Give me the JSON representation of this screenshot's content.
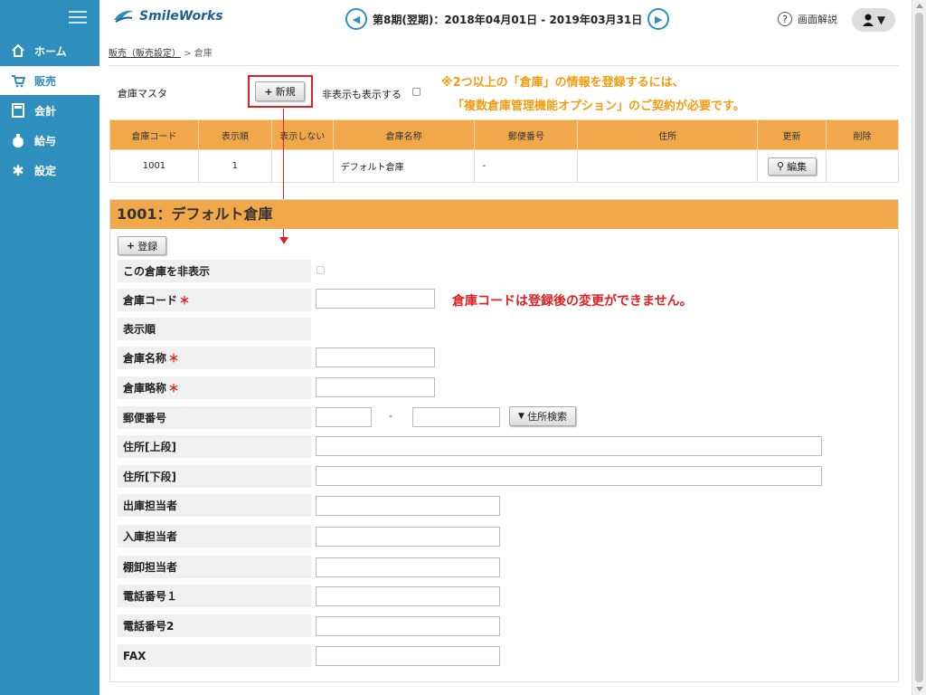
{
  "sidebar": {
    "items": [
      {
        "label": "ホーム",
        "icon": "home-icon"
      },
      {
        "label": "販売",
        "icon": "cart-icon"
      },
      {
        "label": "会計",
        "icon": "calculator-icon"
      },
      {
        "label": "給与",
        "icon": "money-bag-icon"
      },
      {
        "label": "設定",
        "icon": "gear-icon"
      }
    ]
  },
  "header": {
    "logo": "SmileWorks",
    "period": "第8期(翌期)：2018年04月01日 - 2019年03月31日",
    "help": "画面解説"
  },
  "breadcrumb": {
    "link": "販売（販売設定）",
    "sep": ">",
    "current": "倉庫"
  },
  "master": {
    "title": "倉庫マスタ",
    "new_button": "新規",
    "show_hidden": "非表示も表示する",
    "note_line1": "※2つ以上の「倉庫」の情報を登録するには、",
    "note_line2": "「複数倉庫管理機能オプション」のご契約が必要です。"
  },
  "table": {
    "headers": [
      "倉庫コード",
      "表示順",
      "表示しない",
      "倉庫名称",
      "郵便番号",
      "住所",
      "更新",
      "削除"
    ],
    "rows": [
      {
        "code": "1001",
        "order": "1",
        "hidden": "",
        "name": "デフォルト倉庫",
        "zip": "-",
        "address": "",
        "edit": "編集",
        "delete": ""
      }
    ]
  },
  "form": {
    "title": "1001：デフォルト倉庫",
    "register_button": "登録",
    "hide_label": "この倉庫を非表示",
    "code_label": "倉庫コード",
    "order_label": "表示順",
    "name_label": "倉庫名称",
    "short_label": "倉庫略称",
    "zip_label": "郵便番号",
    "zip_sep": "-",
    "addr_search": "住所検索",
    "addr1_label": "住所[上段]",
    "addr2_label": "住所[下段]",
    "out_label": "出庫担当者",
    "in_label": "入庫担当者",
    "stock_label": "棚卸担当者",
    "tel1_label": "電話番号１",
    "tel2_label": "電話番号2",
    "fax_label": "FAX",
    "required_mark": "＊",
    "code_note": "倉庫コードは登録後の変更ができません。"
  },
  "colors": {
    "sidebar": "#2e8fbe",
    "accent": "#f0a84a",
    "note": "#f39c12",
    "alert": "#e02020"
  }
}
